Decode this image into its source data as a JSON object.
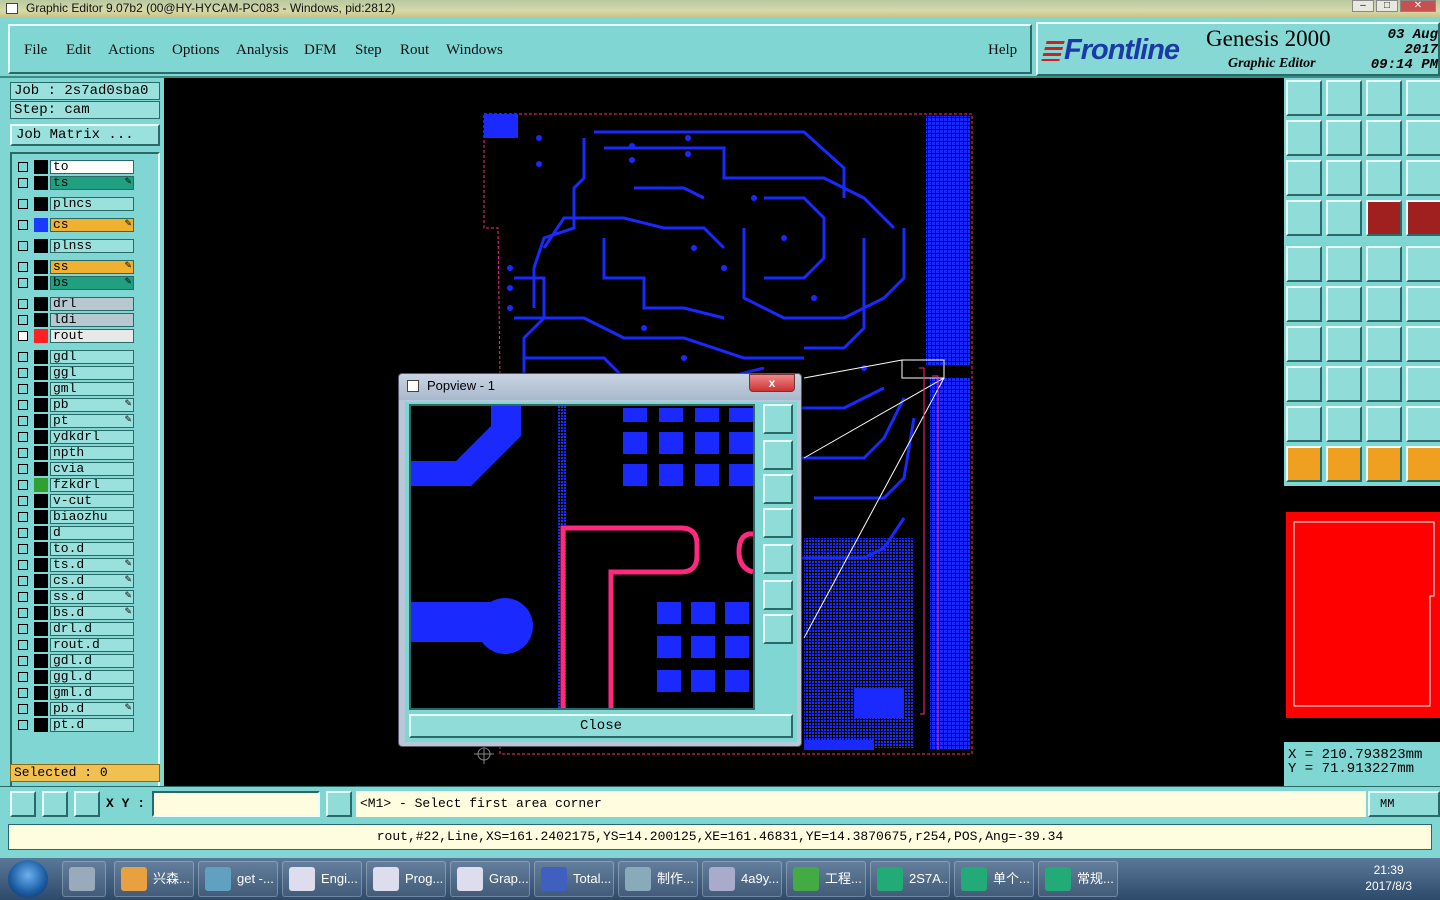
{
  "window": {
    "title": "Graphic Editor 9.07b2 (00@HY-HYCAM-PC083 - Windows, pid:2812)"
  },
  "menu": {
    "items": [
      "File",
      "Edit",
      "Actions",
      "Options",
      "Analysis",
      "DFM",
      "Step",
      "Rout",
      "Windows"
    ],
    "help": "Help"
  },
  "logo": {
    "brand": "Frontline",
    "product": "Genesis 2000",
    "subtitle": "Graphic Editor",
    "date": "03 Aug 2017",
    "time": "09:14 PM"
  },
  "job": {
    "job_label": "Job : 2s7ad0sba0",
    "step_label": "Step: cam",
    "matrix_button": "Job Matrix ..."
  },
  "layers": [
    {
      "name": "to",
      "color": "#000000",
      "bg": "#ffffff"
    },
    {
      "name": "ts",
      "color": "#000000",
      "bg": "#20a080",
      "edit": true
    },
    {
      "name": "plncs",
      "color": "#000000",
      "bg": "#9ae0dc"
    },
    {
      "name": "cs",
      "color": "#1a3aff",
      "bg": "#f0b030",
      "edit": true
    },
    {
      "name": "plnss",
      "color": "#000000",
      "bg": "#9ae0dc"
    },
    {
      "name": "ss",
      "color": "#000000",
      "bg": "#f0b030",
      "edit": true
    },
    {
      "name": "bs",
      "color": "#000000",
      "bg": "#20a080",
      "edit": true
    },
    {
      "name": "drl",
      "color": "#000000",
      "bg": "#b8c8d0"
    },
    {
      "name": "ldi",
      "color": "#000000",
      "bg": "#b8c8d0"
    },
    {
      "name": "rout",
      "color": "#ff2020",
      "bg": "#e8e8e8"
    },
    {
      "name": "gdl",
      "color": "#000000",
      "bg": "#9ae0dc"
    },
    {
      "name": "ggl",
      "color": "#000000",
      "bg": "#9ae0dc"
    },
    {
      "name": "gml",
      "color": "#000000",
      "bg": "#9ae0dc"
    },
    {
      "name": "pb",
      "color": "#000000",
      "bg": "#9ae0dc",
      "edit": true
    },
    {
      "name": "pt",
      "color": "#000000",
      "bg": "#9ae0dc",
      "edit": true
    },
    {
      "name": "ydkdrl",
      "color": "#000000",
      "bg": "#9ae0dc"
    },
    {
      "name": "npth",
      "color": "#000000",
      "bg": "#9ae0dc"
    },
    {
      "name": "cvia",
      "color": "#000000",
      "bg": "#9ae0dc"
    },
    {
      "name": "fzkdrl",
      "color": "#30a030",
      "bg": "#9ae0dc"
    },
    {
      "name": "v-cut",
      "color": "#000000",
      "bg": "#9ae0dc"
    },
    {
      "name": "biaozhu",
      "color": "#000000",
      "bg": "#9ae0dc"
    },
    {
      "name": "d",
      "color": "#000000",
      "bg": "#9ae0dc"
    },
    {
      "name": "to.d",
      "color": "#000000",
      "bg": "#9ae0dc"
    },
    {
      "name": "ts.d",
      "color": "#000000",
      "bg": "#9ae0dc",
      "edit": true
    },
    {
      "name": "cs.d",
      "color": "#000000",
      "bg": "#9ae0dc",
      "edit": true
    },
    {
      "name": "ss.d",
      "color": "#000000",
      "bg": "#9ae0dc",
      "edit": true
    },
    {
      "name": "bs.d",
      "color": "#000000",
      "bg": "#9ae0dc",
      "edit": true
    },
    {
      "name": "drl.d",
      "color": "#000000",
      "bg": "#9ae0dc"
    },
    {
      "name": "rout.d",
      "color": "#000000",
      "bg": "#9ae0dc"
    },
    {
      "name": "gdl.d",
      "color": "#000000",
      "bg": "#9ae0dc"
    },
    {
      "name": "ggl.d",
      "color": "#000000",
      "bg": "#9ae0dc"
    },
    {
      "name": "gml.d",
      "color": "#000000",
      "bg": "#9ae0dc"
    },
    {
      "name": "pb.d",
      "color": "#000000",
      "bg": "#9ae0dc",
      "edit": true
    },
    {
      "name": "pt.d",
      "color": "#000000",
      "bg": "#9ae0dc"
    }
  ],
  "selected": "Selected : 0",
  "coords": {
    "x": "X = 210.793823mm",
    "y": "Y = 71.913227mm"
  },
  "command": {
    "xy_label": "X Y :",
    "xy_value": "",
    "prompt": "<M1> - Select first area corner",
    "units": "MM"
  },
  "status": "rout,#22,Line,XS=161.2402175,YS=14.200125,XE=161.46831,YE=14.3870675,r254,POS,Ang=-39.34",
  "popview": {
    "title": "Popview - 1",
    "close_label": "Close",
    "x_label": "x"
  },
  "taskbar": {
    "items": [
      "兴森...",
      "get -...",
      "Engi...",
      "Prog...",
      "Grap...",
      "Total...",
      "制作...",
      "4a9y...",
      "工程...",
      "2S7A...",
      "单个...",
      "常规..."
    ],
    "time": "21:39",
    "date": "2017/8/3"
  },
  "colors": {
    "panel": "#7fd6d2",
    "copper": "#1a2aff",
    "rout": "#ff2a80",
    "canvas": "#000000"
  }
}
